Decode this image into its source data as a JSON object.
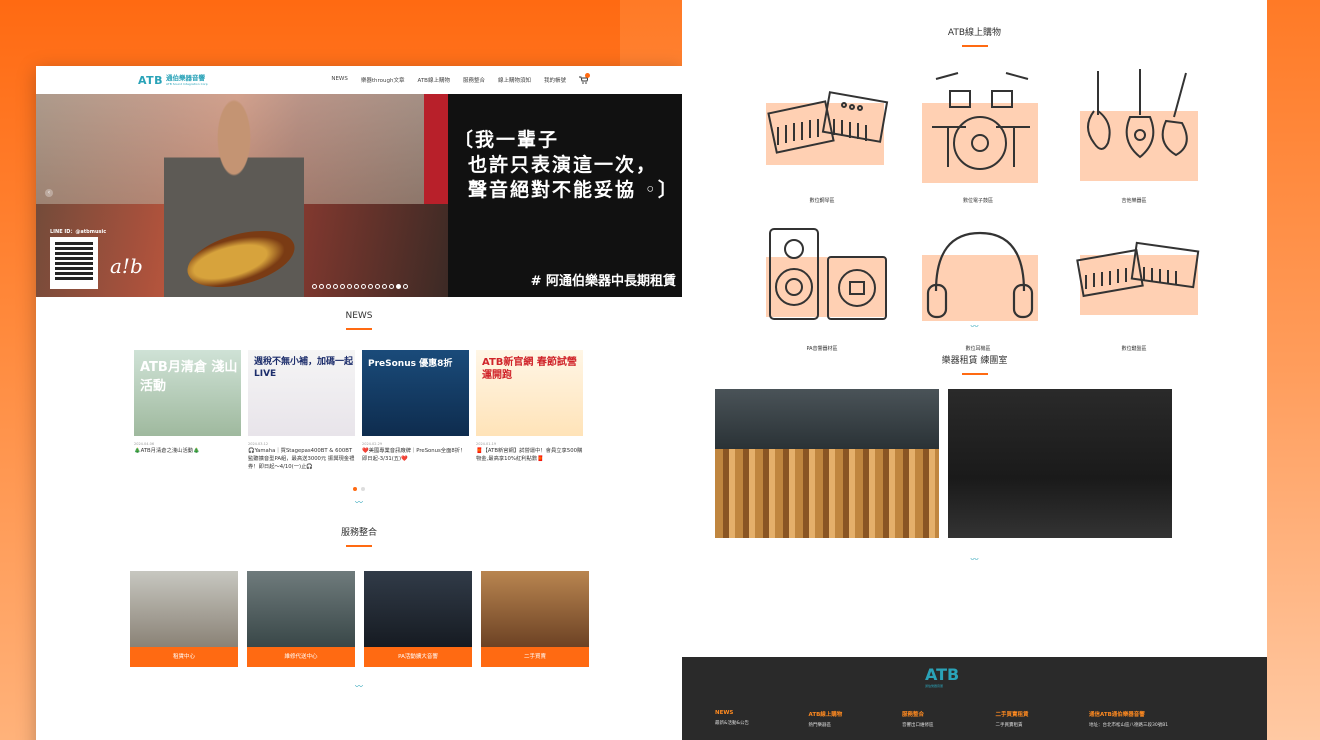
{
  "left_page": {
    "logo": {
      "atb": "ATB",
      "cn": "通伯樂器音響",
      "en": "ATB Sound Integration Corp"
    },
    "nav": [
      "NEWS",
      "樂器through文章",
      "ATB線上購物",
      "服務整合",
      "線上購物須知",
      "我的帳號"
    ],
    "hero": {
      "lines": [
        "〔我一輩子",
        "也許只表演這一次，",
        "聲音絕對不能妥協 ◦〕"
      ],
      "tag": "# 阿通伯樂器中長期租賃",
      "line_id": "LINE ID：@atbmusic",
      "signature": "a!b",
      "slide_count": 14,
      "active_slide": 12
    },
    "news": {
      "title": "NEWS",
      "items": [
        {
          "head": "ATB月清倉 淺山活動",
          "date": "2024.04.06",
          "text": "🎄ATB月清倉之淺山活動🎄"
        },
        {
          "head": "週稅不無小補，加碼一起 LIVE",
          "date": "2024.03.12",
          "text": "🎧Yamaha｜買Stagepas400BT & 600BT監聽擴音型PA組，最高送3000元 振興現金禮券！即日起～4/10(一)止🎧"
        },
        {
          "head": "PreSonus 優惠8折",
          "date": "2024.02.29",
          "text": "❤️美國專業音訊廠牌｜PreSonus全面8折！即日起-3/31(五)❤️"
        },
        {
          "head": "ATB新官網 春節試營運開跑",
          "date": "2024.01.19",
          "text": "🧧【ATB新官網】試營運中！會員立享500購物金,最高享10%紅利點數🧧"
        }
      ],
      "pager_active": 0
    },
    "services": {
      "title": "服務整合",
      "items": [
        "租賃中心",
        "維修代送中心",
        "PA活動擴大音響",
        "二手買賣"
      ]
    }
  },
  "right_page": {
    "shop_title": "ATB線上購物",
    "categories": [
      "數位鋼琴區",
      "數位電子鼓區",
      "吉他樂器區",
      "PA音響器材區",
      "數位耳機區",
      "數位鍵盤區"
    ],
    "rent_title": "樂器租賃 練團室",
    "footer": {
      "logo": "ATB",
      "logo_sub": "通伯樂器音響",
      "cols": [
        {
          "head": "NEWS",
          "text": "最新&活動&公告"
        },
        {
          "head": "ATB線上購物",
          "text": "熱門樂器區"
        },
        {
          "head": "服務整合",
          "text": "音響出口維修區"
        },
        {
          "head": "二手買賣租賃",
          "text": "二手買賣租賃"
        },
        {
          "head": "通信ATB通伯樂器音響",
          "text": "地址：台北市松山區八德路三段30號B1"
        }
      ]
    }
  },
  "colors": {
    "accent": "#ff6a12",
    "teal": "#2aa3b8",
    "peach": "#ffd0b3"
  }
}
